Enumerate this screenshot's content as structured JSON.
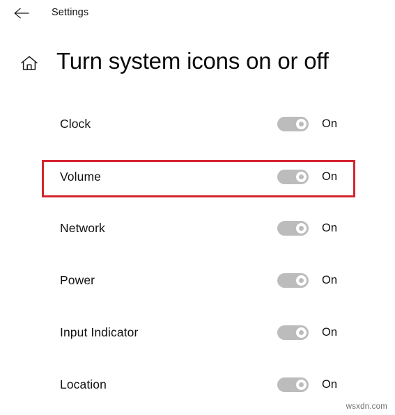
{
  "window": {
    "app_title": "Settings",
    "back_icon": "arrow-left-icon"
  },
  "page": {
    "home_icon": "home-icon",
    "title": "Turn system icons on or off"
  },
  "settings_rows": [
    {
      "label": "Clock",
      "state": "On",
      "toggle_on": true
    },
    {
      "label": "Volume",
      "state": "On",
      "toggle_on": true
    },
    {
      "label": "Network",
      "state": "On",
      "toggle_on": true
    },
    {
      "label": "Power",
      "state": "On",
      "toggle_on": true
    },
    {
      "label": "Input Indicator",
      "state": "On",
      "toggle_on": true
    },
    {
      "label": "Location",
      "state": "On",
      "toggle_on": true
    }
  ],
  "annotation": {
    "target_row": "Volume",
    "color": "#d4252f"
  },
  "watermark": {
    "text": "wsxdn.com"
  },
  "colors": {
    "background": "#ffffff",
    "text": "#111111",
    "toggle_track": "#bcbcbc",
    "toggle_knob": "#ffffff",
    "highlight": "#d4252f"
  }
}
